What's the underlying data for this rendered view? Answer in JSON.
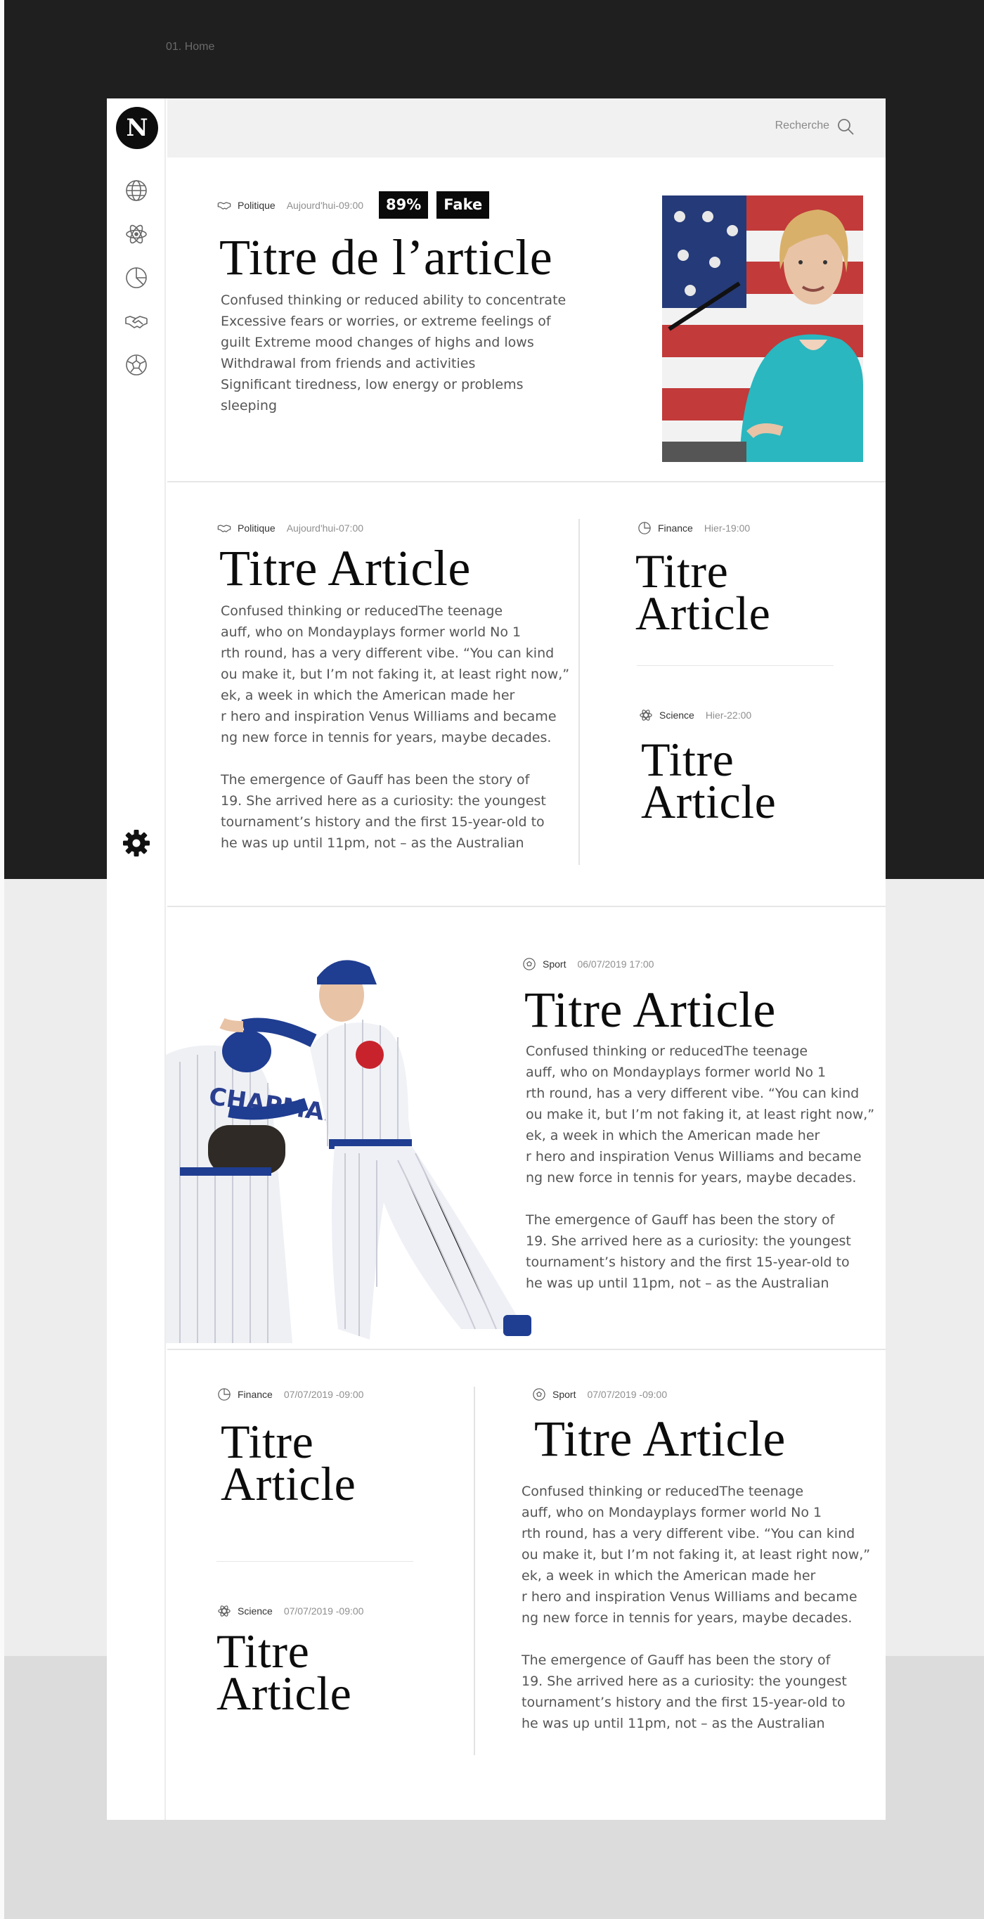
{
  "breadcrumb": "01. Home",
  "logo": "N",
  "nav": [
    {
      "icon": "globe-icon"
    },
    {
      "icon": "atom-icon"
    },
    {
      "icon": "pie-chart-icon"
    },
    {
      "icon": "handshake-icon"
    },
    {
      "icon": "football-icon"
    }
  ],
  "settings_icon": "gear-icon",
  "search": {
    "label": "Recherche",
    "icon": "search-icon"
  },
  "featured": {
    "category": "Politique",
    "time": "Aujourd'hui-09:00",
    "score": "89%",
    "verdict": "Fake",
    "title": "Titre de l’article",
    "body": "Confused thinking or reduced ability to concentrate\nExcessive fears or worries, or extreme feelings of\nguilt Extreme mood changes of highs and lows\nWithdrawal from friends and activities\nSignificant tiredness, low energy or problems\n sleeping"
  },
  "article2": {
    "category": "Politique",
    "time": "Aujourd'hui-07:00",
    "title": "Titre Article",
    "p1": "Confused thinking or reducedThe teenage\nauff, who on Mondayplays former world No 1\nrth round, has a very different vibe. “You can kind\nou make it, but I’m not faking it, at least right now,”\nek, a week in which the American made her\nr hero and inspiration Venus Williams and became\nng new force in tennis for years, maybe decades.",
    "p2": "The emergence of Gauff has been the story of\n19. She arrived here as a curiosity: the youngest\n tournament’s history and the first 15-year-old to\nhe was up until 11pm, not – as the Australian"
  },
  "side1": {
    "category": "Finance",
    "time": "Hier-19:00",
    "title_l1": "Titre",
    "title_l2": "Article"
  },
  "side2": {
    "category": "Science",
    "time": "Hier-22:00",
    "title_l1": "Titre",
    "title_l2": "Article"
  },
  "sport": {
    "category": "Sport",
    "time": "06/07/2019  17:00",
    "title": "Titre Article",
    "p1": "Confused thinking or reducedThe teenage\nauff, who on Mondayplays former world No 1\nrth round, has a very different vibe. “You can kind\nou make it, but I’m not faking it, at least right now,”\nek, a week in which the American made her\nr hero and inspiration Venus Williams and became\nng new force in tennis for years, maybe decades.",
    "p2": "The emergence of Gauff has been the story of\n19. She arrived here as a curiosity: the youngest\n tournament’s history and the first 15-year-old to\nhe was up until 11pm, not – as the Australian"
  },
  "side3": {
    "category": "Finance",
    "time": "07/07/2019 -09:00",
    "title_l1": "Titre",
    "title_l2": "Article"
  },
  "side4": {
    "category": "Science",
    "time": "07/07/2019 -09:00",
    "title_l1": "Titre",
    "title_l2": "Article"
  },
  "sport2": {
    "category": "Sport",
    "time": "07/07/2019 -09:00",
    "title": "Titre Article",
    "p1": "Confused thinking or reducedThe teenage\nauff, who on Mondayplays former world No 1\nrth round, has a very different vibe. “You can kind\nou make it, but I’m not faking it, at least right now,”\nek, a week in which the American made her\nr hero and inspiration Venus Williams and became\nng new force in tennis for years, maybe decades.",
    "p2": "The emergence of Gauff has been the story of\n19. She arrived here as a curiosity: the youngest\n tournament’s history and the first 15-year-old to\nhe was up until 11pm, not – as the Australian"
  },
  "colors": {
    "accent": "#0a0a0a",
    "page_dark": "#1f1f1f",
    "page_light": "#ededee",
    "muted_text": "#8f8f8f"
  }
}
